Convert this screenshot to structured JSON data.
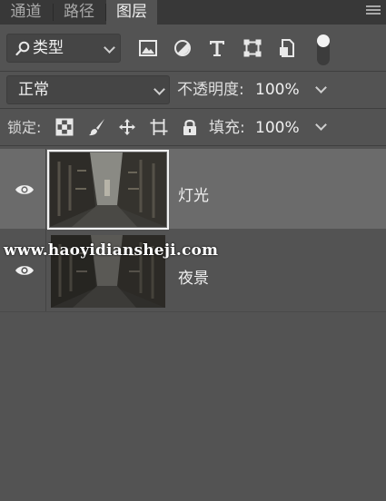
{
  "tabs": [
    {
      "label": "通道",
      "active": false
    },
    {
      "label": "路径",
      "active": false
    },
    {
      "label": "图层",
      "active": true
    }
  ],
  "filter": {
    "kind_label": "类型",
    "icons": [
      "image-filter-icon",
      "adjustment-filter-icon",
      "type-filter-icon",
      "shape-filter-icon",
      "smart-object-filter-icon"
    ]
  },
  "blend": {
    "mode": "正常",
    "opacity_label": "不透明度:",
    "opacity_value": "100%"
  },
  "lock": {
    "label": "锁定:",
    "fill_label": "填充:",
    "fill_value": "100%"
  },
  "layers": [
    {
      "name": "灯光",
      "visible": true,
      "selected": true
    },
    {
      "name": "夜景",
      "visible": true,
      "selected": false
    }
  ],
  "watermark": "www.haoyidiansheji.com",
  "colors": {
    "panel_bg": "#535353",
    "tabbar_bg": "#383838",
    "selected_layer": "#6b6b6b",
    "text": "#f0f0f0"
  }
}
